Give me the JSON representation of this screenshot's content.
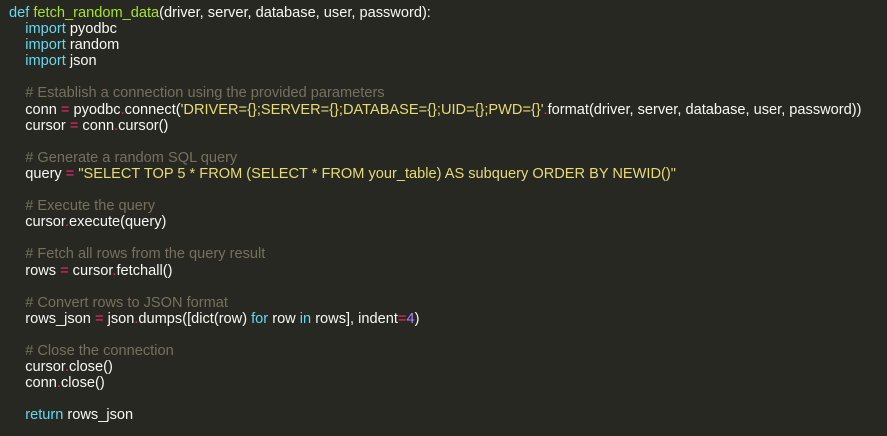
{
  "editor": {
    "theme": {
      "background": "#272822",
      "text": "#f8f8f2",
      "keyword": "#66d9ef",
      "function_name": "#a6e22e",
      "string": "#e6db74",
      "comment": "#75715e",
      "number": "#ae81ff",
      "operator": "#f92672"
    },
    "lines": [
      [
        {
          "t": "kw",
          "v": "def"
        },
        {
          "t": "plain",
          "v": " "
        },
        {
          "t": "fn",
          "v": "fetch_random_data"
        },
        {
          "t": "plain",
          "v": "(driver, server, database, user, password):"
        }
      ],
      [
        {
          "t": "plain",
          "v": "    "
        },
        {
          "t": "kw",
          "v": "import"
        },
        {
          "t": "plain",
          "v": " pyodbc"
        }
      ],
      [
        {
          "t": "plain",
          "v": "    "
        },
        {
          "t": "kw",
          "v": "import"
        },
        {
          "t": "plain",
          "v": " random"
        }
      ],
      [
        {
          "t": "plain",
          "v": "    "
        },
        {
          "t": "kw",
          "v": "import"
        },
        {
          "t": "plain",
          "v": " json"
        }
      ],
      [
        {
          "t": "plain",
          "v": ""
        }
      ],
      [
        {
          "t": "plain",
          "v": "    "
        },
        {
          "t": "cm",
          "v": "# Establish a connection using the provided parameters"
        }
      ],
      [
        {
          "t": "plain",
          "v": "    conn "
        },
        {
          "t": "op",
          "v": "="
        },
        {
          "t": "plain",
          "v": " pyodbc"
        },
        {
          "t": "op",
          "v": "."
        },
        {
          "t": "plain",
          "v": "connect("
        },
        {
          "t": "str",
          "v": "'DRIVER={};SERVER={};DATABASE={};UID={};PWD={}'"
        },
        {
          "t": "op",
          "v": "."
        },
        {
          "t": "plain",
          "v": "format(driver, server, database, user, password))"
        }
      ],
      [
        {
          "t": "plain",
          "v": "    cursor "
        },
        {
          "t": "op",
          "v": "="
        },
        {
          "t": "plain",
          "v": " conn"
        },
        {
          "t": "op",
          "v": "."
        },
        {
          "t": "plain",
          "v": "cursor()"
        }
      ],
      [
        {
          "t": "plain",
          "v": ""
        }
      ],
      [
        {
          "t": "plain",
          "v": "    "
        },
        {
          "t": "cm",
          "v": "# Generate a random SQL query"
        }
      ],
      [
        {
          "t": "plain",
          "v": "    query "
        },
        {
          "t": "op",
          "v": "="
        },
        {
          "t": "plain",
          "v": " "
        },
        {
          "t": "str",
          "v": "\"SELECT TOP 5 * FROM (SELECT * FROM your_table) AS subquery ORDER BY NEWID()\""
        }
      ],
      [
        {
          "t": "plain",
          "v": ""
        }
      ],
      [
        {
          "t": "plain",
          "v": "    "
        },
        {
          "t": "cm",
          "v": "# Execute the query"
        }
      ],
      [
        {
          "t": "plain",
          "v": "    cursor"
        },
        {
          "t": "op",
          "v": "."
        },
        {
          "t": "plain",
          "v": "execute(query)"
        }
      ],
      [
        {
          "t": "plain",
          "v": ""
        }
      ],
      [
        {
          "t": "plain",
          "v": "    "
        },
        {
          "t": "cm",
          "v": "# Fetch all rows from the query result"
        }
      ],
      [
        {
          "t": "plain",
          "v": "    rows "
        },
        {
          "t": "op",
          "v": "="
        },
        {
          "t": "plain",
          "v": " cursor"
        },
        {
          "t": "op",
          "v": "."
        },
        {
          "t": "plain",
          "v": "fetchall()"
        }
      ],
      [
        {
          "t": "plain",
          "v": ""
        }
      ],
      [
        {
          "t": "plain",
          "v": "    "
        },
        {
          "t": "cm",
          "v": "# Convert rows to JSON format"
        }
      ],
      [
        {
          "t": "plain",
          "v": "    rows_json "
        },
        {
          "t": "op",
          "v": "="
        },
        {
          "t": "plain",
          "v": " json"
        },
        {
          "t": "op",
          "v": "."
        },
        {
          "t": "plain",
          "v": "dumps([dict(row) "
        },
        {
          "t": "kw",
          "v": "for"
        },
        {
          "t": "plain",
          "v": " row "
        },
        {
          "t": "kw",
          "v": "in"
        },
        {
          "t": "plain",
          "v": " rows], indent"
        },
        {
          "t": "op",
          "v": "="
        },
        {
          "t": "num",
          "v": "4"
        },
        {
          "t": "plain",
          "v": ")"
        }
      ],
      [
        {
          "t": "plain",
          "v": ""
        }
      ],
      [
        {
          "t": "plain",
          "v": "    "
        },
        {
          "t": "cm",
          "v": "# Close the connection"
        }
      ],
      [
        {
          "t": "plain",
          "v": "    cursor"
        },
        {
          "t": "op",
          "v": "."
        },
        {
          "t": "plain",
          "v": "close()"
        }
      ],
      [
        {
          "t": "plain",
          "v": "    conn"
        },
        {
          "t": "op",
          "v": "."
        },
        {
          "t": "plain",
          "v": "close()"
        }
      ],
      [
        {
          "t": "plain",
          "v": ""
        }
      ],
      [
        {
          "t": "plain",
          "v": "    "
        },
        {
          "t": "kw",
          "v": "return"
        },
        {
          "t": "plain",
          "v": " rows_json"
        }
      ]
    ]
  }
}
